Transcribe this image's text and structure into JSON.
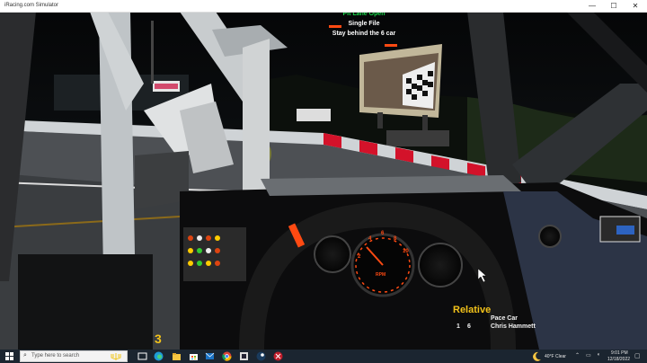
{
  "window": {
    "title": "iRacing.com Simulator",
    "minimize_glyph": "—",
    "maximize_glyph": "☐",
    "close_glyph": "✕"
  },
  "hud": {
    "messages": [
      {
        "text": "Pit Lane Open",
        "color": "#19d64a"
      },
      {
        "text": "Single File",
        "color": "#ffffff"
      },
      {
        "text": "Stay behind the 6 car",
        "color": "#ffffff"
      }
    ]
  },
  "dashboard": {
    "tach_labels": [
      "2",
      "4",
      "6",
      "8",
      "10"
    ],
    "tach_unit": "RPM",
    "position_digit": "3",
    "colors": {
      "tach": "#ff4a12",
      "body": "#111"
    }
  },
  "relative": {
    "title": "Relative",
    "rows": [
      {
        "pos": "",
        "car": "",
        "name": "Pace Car"
      },
      {
        "pos": "1",
        "car": "6",
        "name": "Chris Hammett"
      }
    ]
  },
  "taskbar": {
    "search_placeholder": "Type here to search",
    "icons": [
      "windows-start-icon",
      "search-icon",
      "menorah-icon",
      "task-view-icon",
      "edge-icon",
      "file-explorer-icon",
      "store-icon",
      "mail-icon",
      "chrome-icon",
      "iracing-icon",
      "steam-icon",
      "app-icon"
    ],
    "weather": "40°F  Clear",
    "time": "9:01 PM",
    "date": "12/18/2022"
  }
}
